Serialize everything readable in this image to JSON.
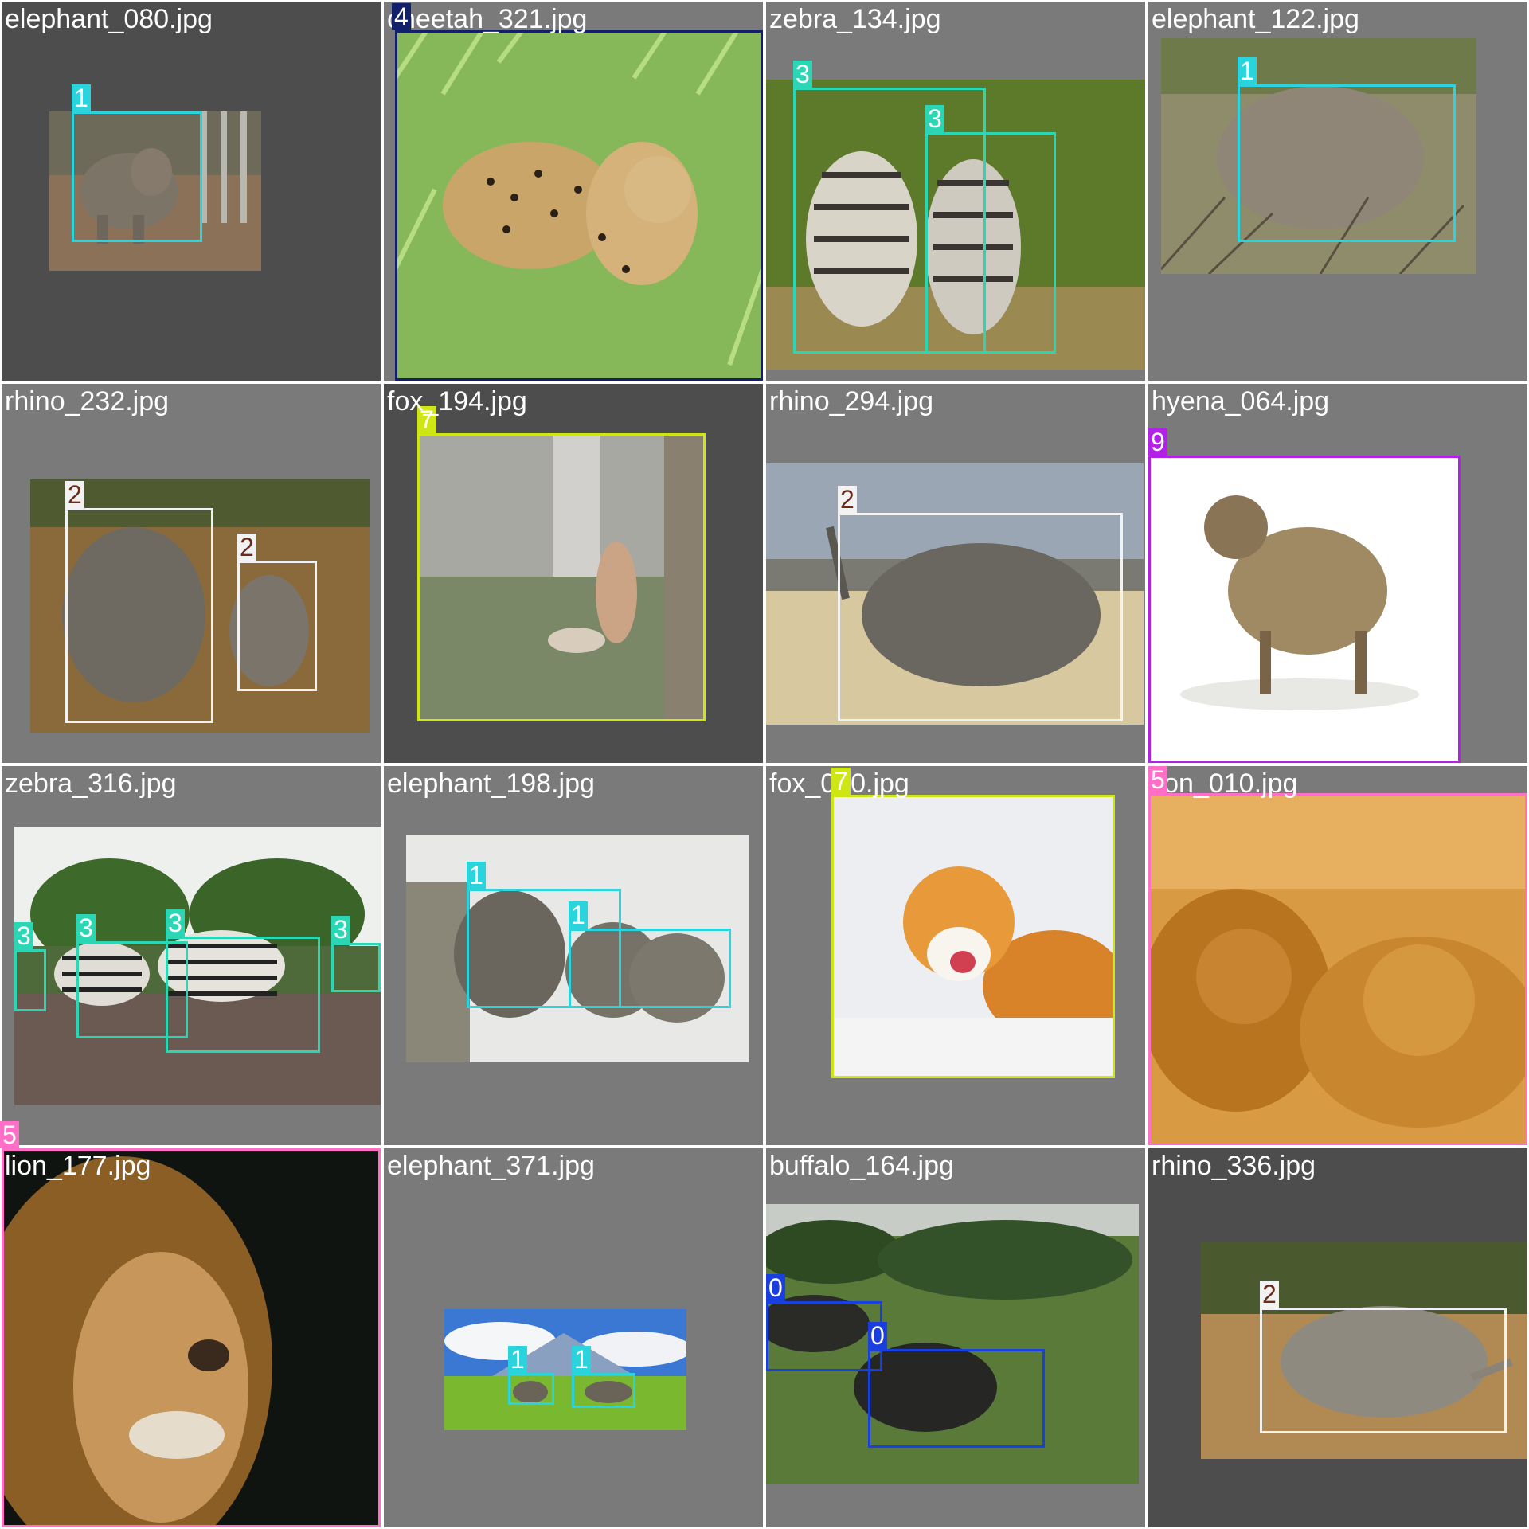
{
  "legend_colors": {
    "0": "#1a3fe0",
    "1": "#2bd3dc",
    "2": "#f2f2f2",
    "3": "#2ad6b4",
    "4": "#12206a",
    "5": "#ff6ec7",
    "7": "#cde614",
    "9": "#b320e6"
  },
  "tiles": [
    {
      "filename": "elephant_080.jpg",
      "labels": [
        "1"
      ]
    },
    {
      "filename": "cheetah_321.jpg",
      "labels": [
        "4"
      ]
    },
    {
      "filename": "zebra_134.jpg",
      "labels": [
        "3",
        "3"
      ]
    },
    {
      "filename": "elephant_122.jpg",
      "labels": [
        "1"
      ]
    },
    {
      "filename": "rhino_232.jpg",
      "labels": [
        "2",
        "2"
      ]
    },
    {
      "filename": "fox_194.jpg",
      "labels": [
        "7"
      ]
    },
    {
      "filename": "rhino_294.jpg",
      "labels": [
        "2"
      ]
    },
    {
      "filename": "hyena_064.jpg",
      "labels": [
        "9"
      ]
    },
    {
      "filename": "zebra_316.jpg",
      "labels": [
        "3",
        "3",
        "3",
        "3"
      ]
    },
    {
      "filename": "elephant_198.jpg",
      "labels": [
        "1",
        "1"
      ]
    },
    {
      "filename": "fox_060.jpg",
      "labels": [
        "7"
      ]
    },
    {
      "filename": "lion_010.jpg",
      "labels": [
        "5"
      ]
    },
    {
      "filename": "lion_177.jpg",
      "labels": [
        "5"
      ]
    },
    {
      "filename": "elephant_371.jpg",
      "labels": [
        "1",
        "1"
      ]
    },
    {
      "filename": "buffalo_164.jpg",
      "labels": [
        "0",
        "0"
      ]
    },
    {
      "filename": "rhino_336.jpg",
      "labels": [
        "2"
      ]
    }
  ]
}
